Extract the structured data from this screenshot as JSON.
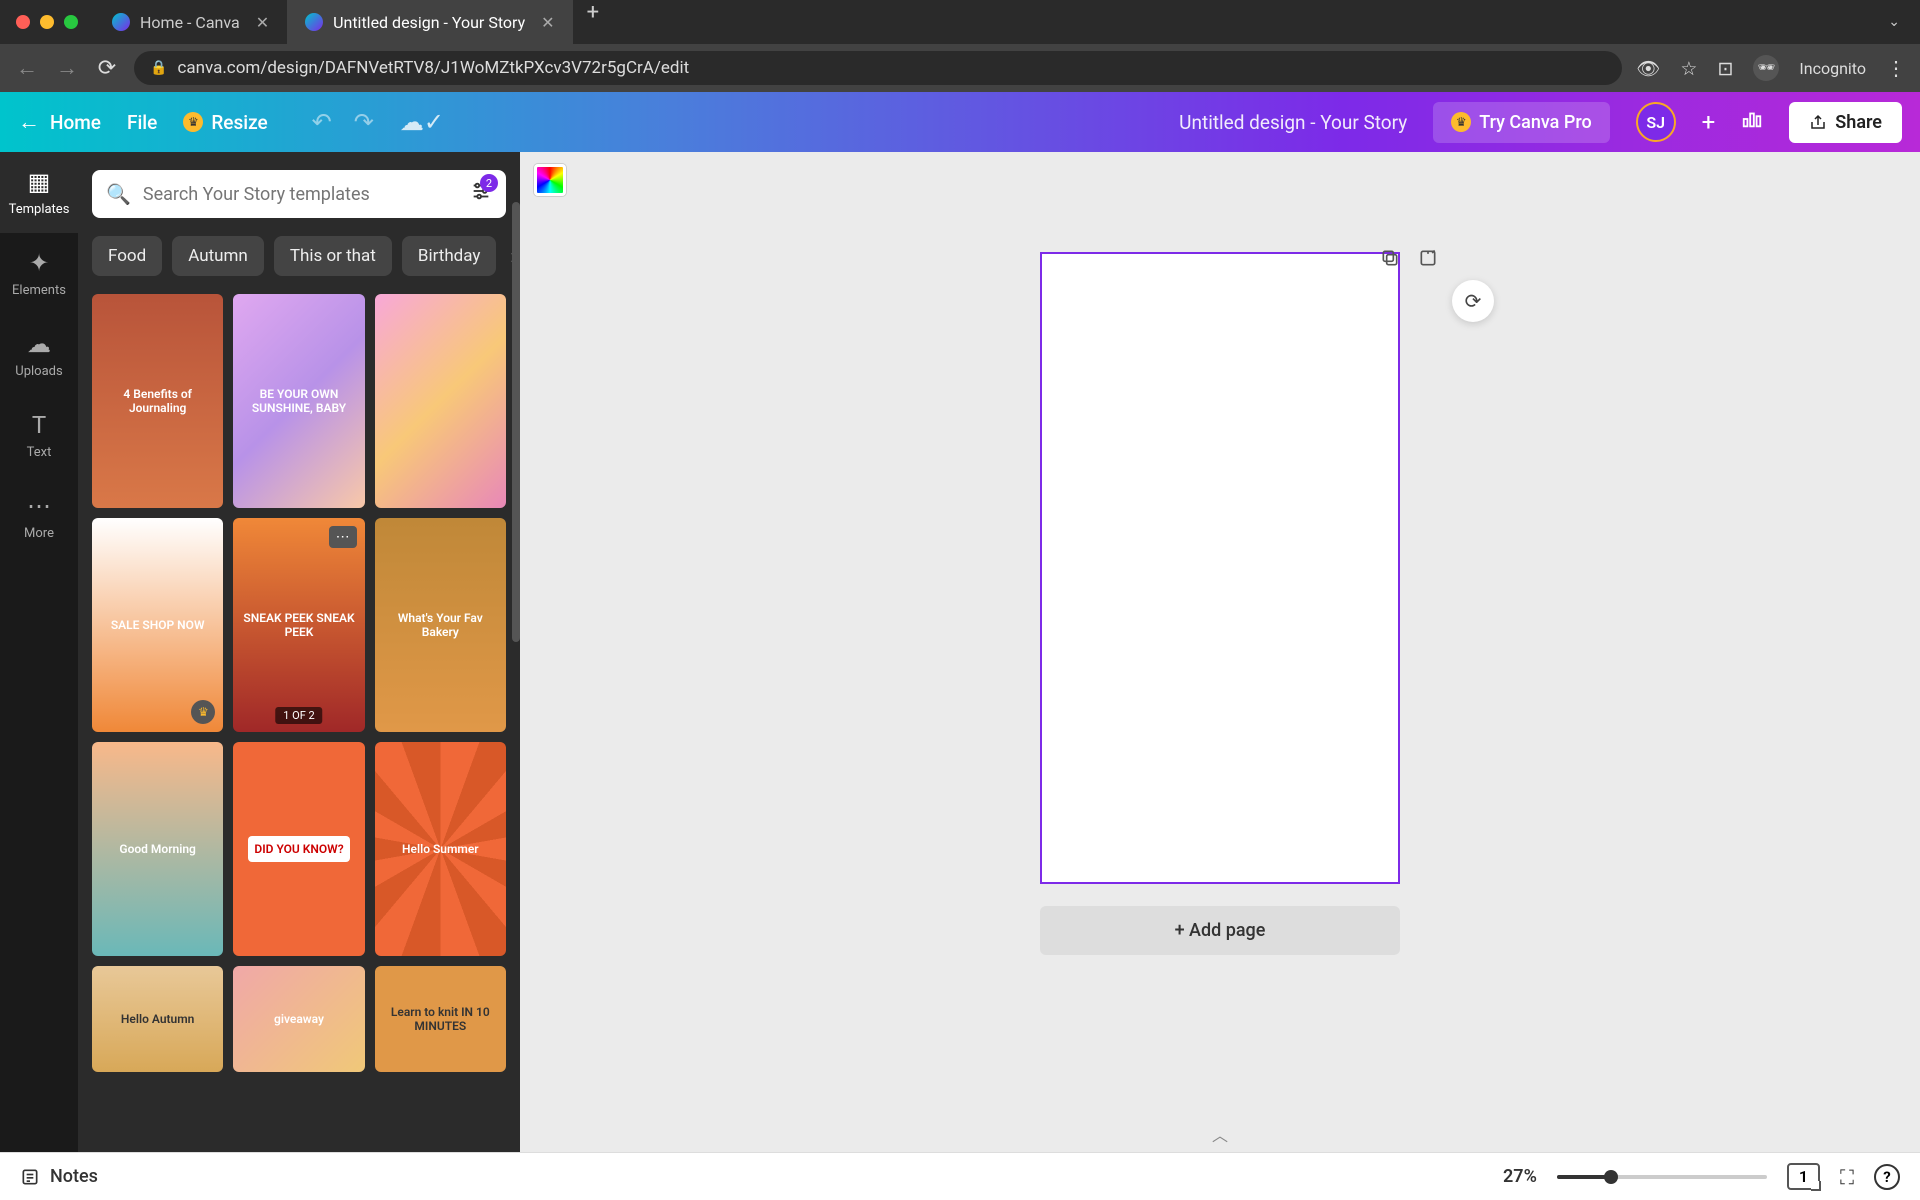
{
  "browser": {
    "tabs": [
      {
        "title": "Home - Canva",
        "active": false
      },
      {
        "title": "Untitled design - Your Story",
        "active": true
      }
    ],
    "url": "canva.com/design/DAFNVetRTV8/J1WoMZtkPXcv3V72r5gCrA/edit",
    "incognito_label": "Incognito"
  },
  "toolbar": {
    "home": "Home",
    "file": "File",
    "resize": "Resize",
    "doc_title": "Untitled design - Your Story",
    "try_pro": "Try Canva Pro",
    "avatar_initials": "SJ",
    "share": "Share"
  },
  "side_rail": [
    {
      "label": "Templates",
      "icon": "⊞",
      "active": true
    },
    {
      "label": "Elements",
      "icon": "✦",
      "active": false
    },
    {
      "label": "Uploads",
      "icon": "☁",
      "active": false
    },
    {
      "label": "Text",
      "icon": "T",
      "active": false
    },
    {
      "label": "More",
      "icon": "⋯",
      "active": false
    }
  ],
  "panel": {
    "search_placeholder": "Search Your Story templates",
    "filter_count": "2",
    "chips": [
      "Food",
      "Autumn",
      "This or that",
      "Birthday"
    ],
    "templates": [
      {
        "label": "4 Benefits of Journaling",
        "cls": "tc1"
      },
      {
        "label": "BE YOUR OWN SUNSHINE, BABY",
        "cls": "tc2"
      },
      {
        "label": "",
        "cls": "tc3"
      },
      {
        "label": "SALE SHOP NOW",
        "cls": "tc4",
        "crown": true
      },
      {
        "label": "SNEAK PEEK SNEAK PEEK",
        "cls": "tc5",
        "pages": "1 OF 2",
        "menu": true
      },
      {
        "label": "What's Your Fav Bakery",
        "cls": "tc6"
      },
      {
        "label": "Good Morning",
        "cls": "tc7"
      },
      {
        "label": "DID YOU KNOW?",
        "cls": "tc8"
      },
      {
        "label": "Hello Summer",
        "cls": "tc9"
      },
      {
        "label": "Hello Autumn",
        "cls": "tc10"
      },
      {
        "label": "giveaway",
        "cls": "tc11"
      },
      {
        "label": "Learn to knit IN 10 MINUTES",
        "cls": "tc12"
      }
    ]
  },
  "canvas": {
    "add_page": "+ Add page"
  },
  "bottom": {
    "notes": "Notes",
    "zoom_pct": "27%",
    "page_count": "1",
    "help": "?"
  }
}
